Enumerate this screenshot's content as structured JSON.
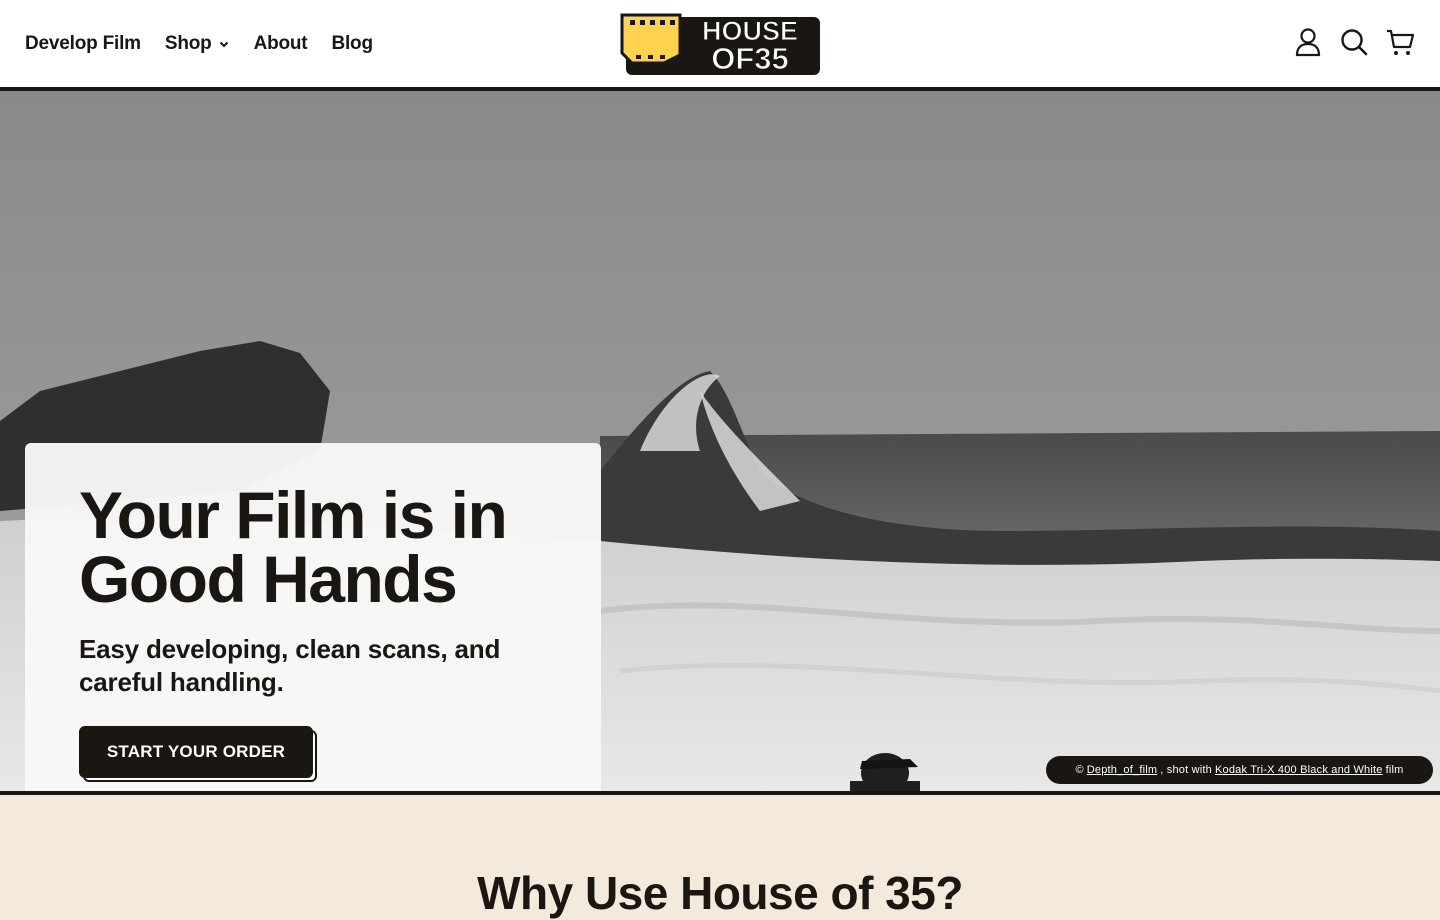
{
  "nav": {
    "items": [
      {
        "label": "Develop Film"
      },
      {
        "label": "Shop",
        "has_dropdown": true
      },
      {
        "label": "About"
      },
      {
        "label": "Blog"
      }
    ]
  },
  "logo": {
    "line1": "HOUSE",
    "line2": "OF35",
    "accent": "#ffd24f"
  },
  "header_icons": [
    "account-icon",
    "search-icon",
    "cart-icon"
  ],
  "hero": {
    "title": "Your Film is in Good Hands",
    "subtitle": "Easy developing, clean scans, and careful handling.",
    "cta_label": "START YOUR ORDER"
  },
  "credit": {
    "prefix": "©",
    "author": "Depth_of_film",
    "middle": ", shot with",
    "film": "Kodak Tri-X 400 Black and White",
    "suffix": "film"
  },
  "section": {
    "title": "Why Use House of 35?"
  },
  "colors": {
    "ink": "#1a1712",
    "cream": "#f4eadb",
    "yellow": "#ffd24f"
  }
}
